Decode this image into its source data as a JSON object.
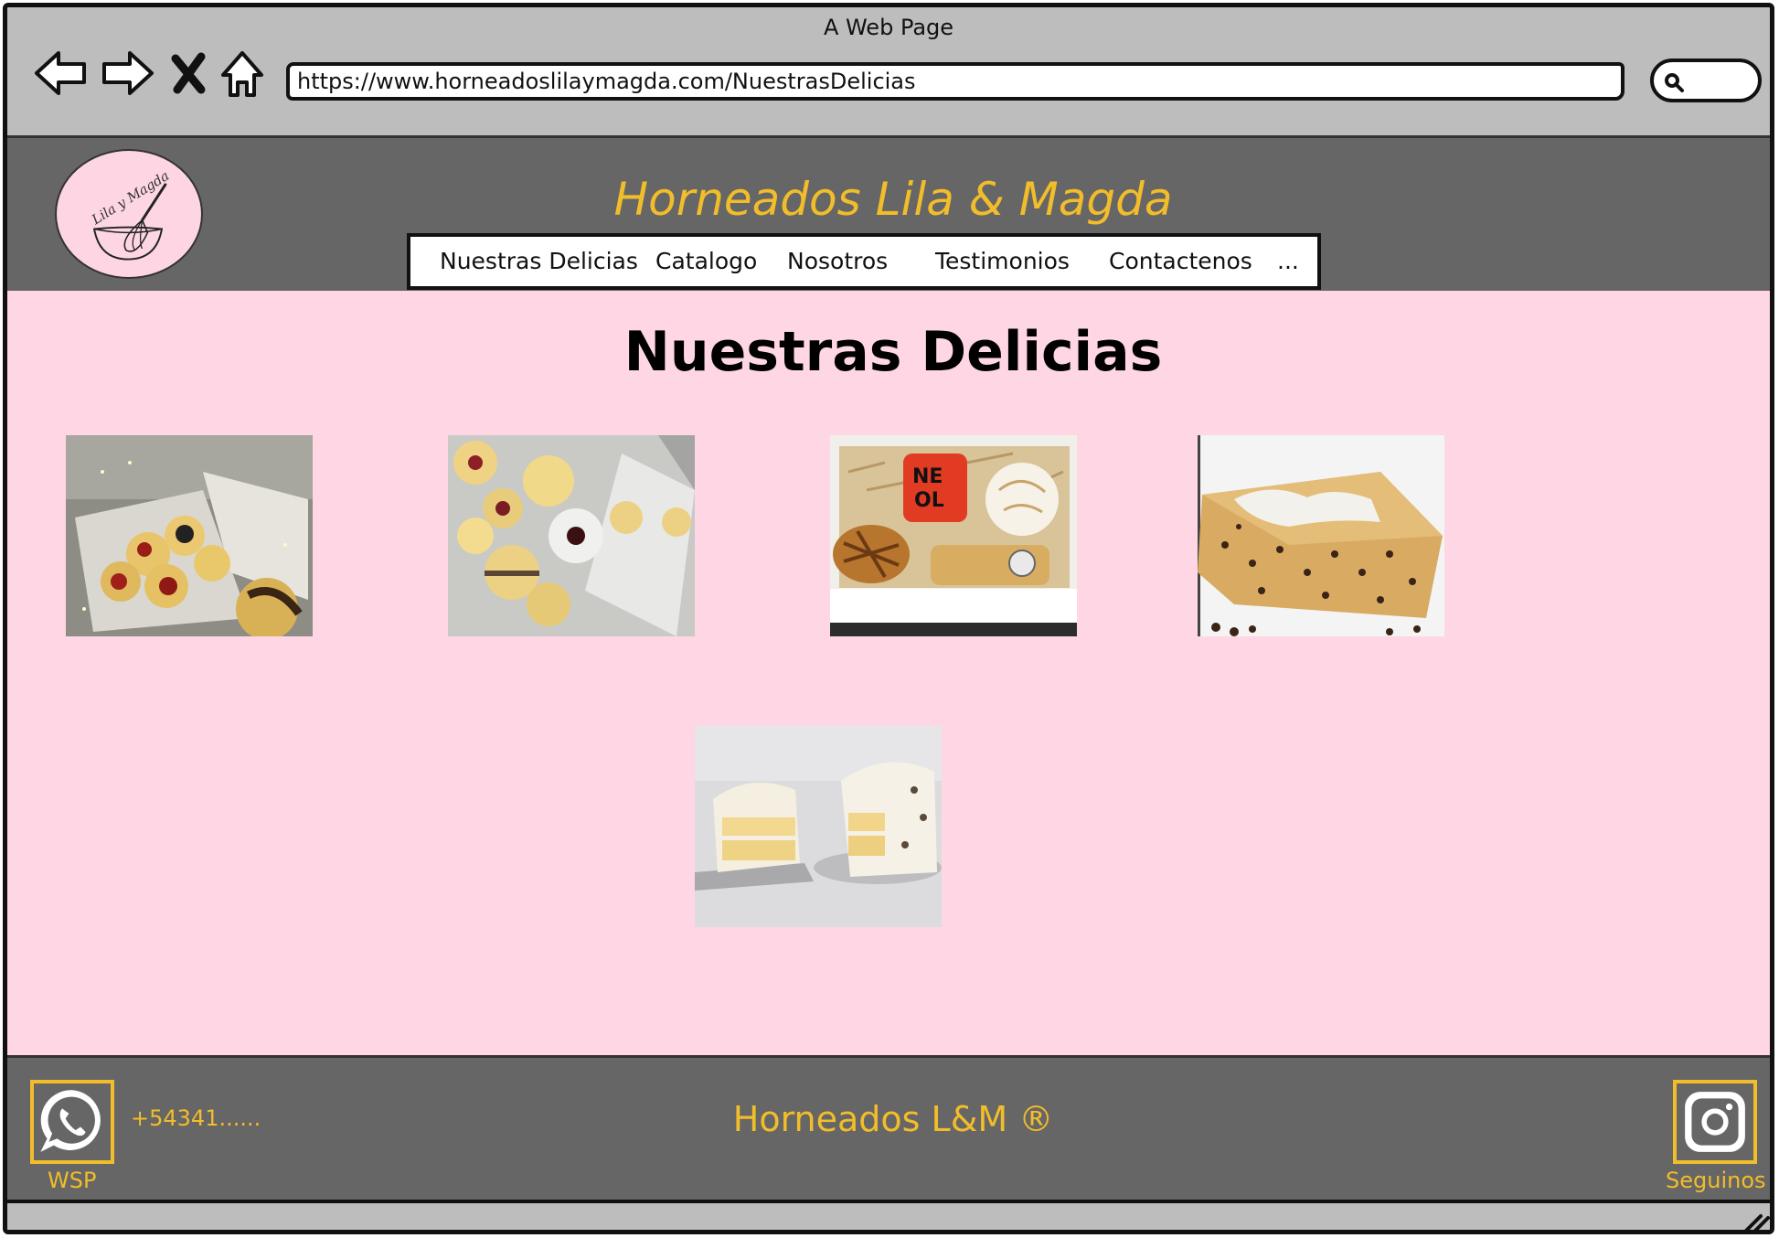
{
  "window": {
    "title": "A Web Page",
    "url": "https://www.horneadoslilaymagda.com/NuestrasDelicias"
  },
  "header": {
    "logo_text": "Lila y Magda",
    "brand": "Horneados Lila & Magda",
    "nav": [
      {
        "label": "Nuestras Delicias"
      },
      {
        "label": "Catalogo"
      },
      {
        "label": "Nosotros"
      },
      {
        "label": "Testimonios"
      },
      {
        "label": "Contactenos"
      },
      {
        "label": "..."
      }
    ]
  },
  "main": {
    "heading": "Nuestras Delicias",
    "photos": [
      {
        "name": "photo-alfajores-box"
      },
      {
        "name": "photo-cookies-box"
      },
      {
        "name": "photo-gift-box"
      },
      {
        "name": "photo-chocolate-chip-cake"
      },
      {
        "name": "photo-cream-cake"
      }
    ]
  },
  "footer": {
    "phone": "+54341......",
    "wsp_label": "WSP",
    "brand": "Horneados L&M ®",
    "instagram_label": "Seguinos"
  },
  "colors": {
    "accent": "#f2bd2a",
    "header_bg": "#666666",
    "content_bg": "#ffd6e4",
    "chrome_bg": "#bdbdbd"
  }
}
